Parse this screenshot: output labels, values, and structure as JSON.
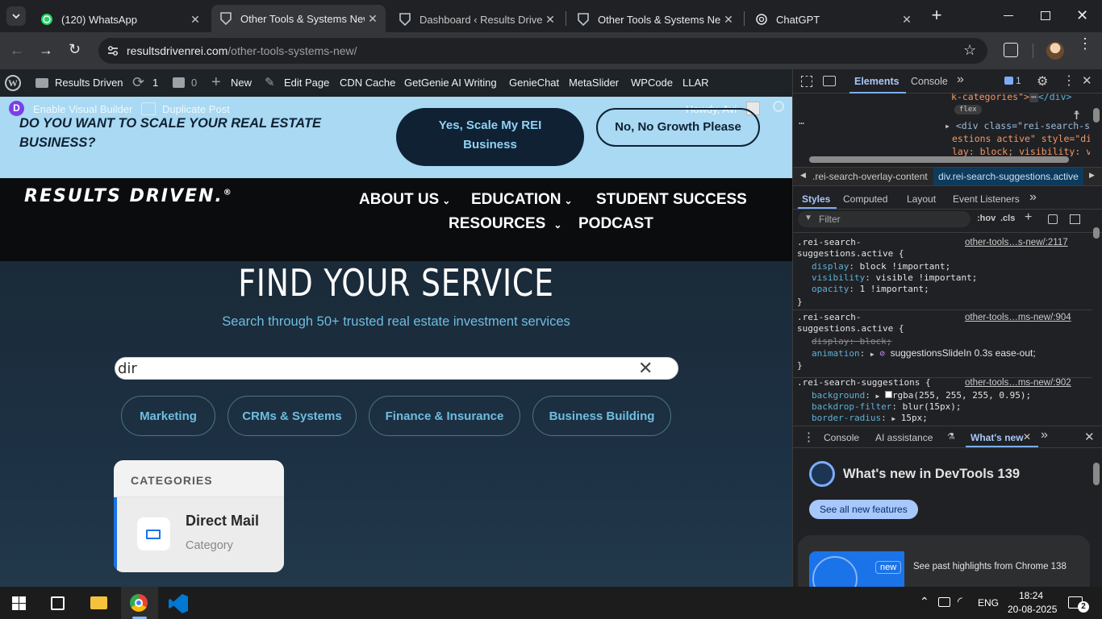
{
  "tabs": [
    {
      "title": "(120) WhatsApp",
      "icon": "whatsapp-icon",
      "active": false
    },
    {
      "title": "Other Tools & Systems New",
      "icon": "site-favicon",
      "active": true
    },
    {
      "title": "Dashboard ‹ Results Driven —",
      "icon": "site-favicon",
      "active": false
    },
    {
      "title": "Other Tools & Systems New",
      "icon": "site-favicon",
      "active": false
    },
    {
      "title": "ChatGPT",
      "icon": "chatgpt-icon",
      "active": false
    }
  ],
  "address": {
    "domain": "resultsdrivenrei.com",
    "path": "/other-tools-systems-new/"
  },
  "wpbar": {
    "site_name": "Results Driven",
    "updates_count": "1",
    "comments_count": "0",
    "new_label": "New",
    "edit_page": "Edit Page",
    "cdn_cache": "CDN Cache",
    "getgenie": "GetGenie AI Writing",
    "geniechat": "GenieChat",
    "metaslider": "MetaSlider",
    "wpcode": "WPCode",
    "llar": "LLAR",
    "visual_builder": "Enable Visual Builder",
    "duplicate_post": "Duplicate Post",
    "howdy": "Howdy, Avi"
  },
  "promo": {
    "question": "DO YOU WANT TO SCALE YOUR REAL ESTATE BUSINESS?",
    "yes_label": "Yes, Scale My REI Business",
    "no_label": "No, No Growth Please"
  },
  "nav": {
    "logo": "RESULTS DRIVEN.",
    "logo_mark": "®",
    "items": [
      "ABOUT US",
      "EDUCATION",
      "STUDENT SUCCESS",
      "RESOURCES",
      "PODCAST"
    ]
  },
  "hero": {
    "title": "FIND YOUR SERVICE",
    "subtitle": "Search through 50+ trusted real estate investment services",
    "search_value": "dir",
    "filters": [
      "Marketing",
      "CRMs & Systems",
      "Finance & Insurance",
      "Business Building"
    ],
    "suggest_header": "CATEGORIES",
    "suggest_title": "Direct Mail",
    "suggest_sub": "Category"
  },
  "devtools": {
    "tabs": [
      "Elements",
      "Console"
    ],
    "issues_count": "1",
    "dom_line1": "k-categories\">",
    "dom_line1_end": "</div>",
    "dom_badge": "flex",
    "dom_line2": "<div class=\"rei-search-sug",
    "dom_line3": "estions active\" style=\"dis",
    "dom_line4": "lay: block; visibility: vi",
    "crumbs": [
      ".rei-search-overlay-content",
      "div.rei-search-suggestions.active"
    ],
    "style_tabs": [
      "Styles",
      "Computed",
      "Layout",
      "Event Listeners"
    ],
    "filter_placeholder": "Filter",
    "hov": ":hov",
    "cls": ".cls",
    "rules": [
      {
        "sel1": ".rei-search-",
        "sel2": "suggestions.active {",
        "src": "other-tools…s-new/:2117",
        "decls": [
          [
            "display",
            "block !important;"
          ],
          [
            "visibility",
            "visible !important;"
          ],
          [
            "opacity",
            "1 !important;"
          ]
        ]
      },
      {
        "sel1": ".rei-search-",
        "sel2": "suggestions.active {",
        "src": "other-tools…ms-new/:904",
        "decls": [
          [
            "display",
            "block;"
          ],
          [
            "animation",
            "suggestionsSlideIn 0.3s ease-out;"
          ]
        ]
      },
      {
        "sel1": ".rei-search-suggestions {",
        "sel2": "",
        "src": "other-tools…ms-new/:902",
        "decls": [
          [
            "background",
            "rgba(255, 255, 255, 0.95);"
          ],
          [
            "backdrop-filter",
            "blur(15px);"
          ],
          [
            "border-radius",
            "15px;"
          ]
        ]
      }
    ],
    "drawer_tabs": [
      "Console",
      "AI assistance",
      "What's new"
    ],
    "whatsnew_title": "What's new in DevTools 139",
    "see_all": "See all new features",
    "new_badge": "new",
    "past_highlights": "See past highlights from Chrome 138"
  },
  "taskbar": {
    "lang": "ENG",
    "time": "18:24",
    "date": "20-08-2025",
    "notif_count": "2"
  },
  "colors": {
    "accent_blue": "#1a73e8",
    "promo_bg": "#a9d9f3",
    "brand_dark": "#0f2133",
    "pill_text": "#6fbde0"
  }
}
